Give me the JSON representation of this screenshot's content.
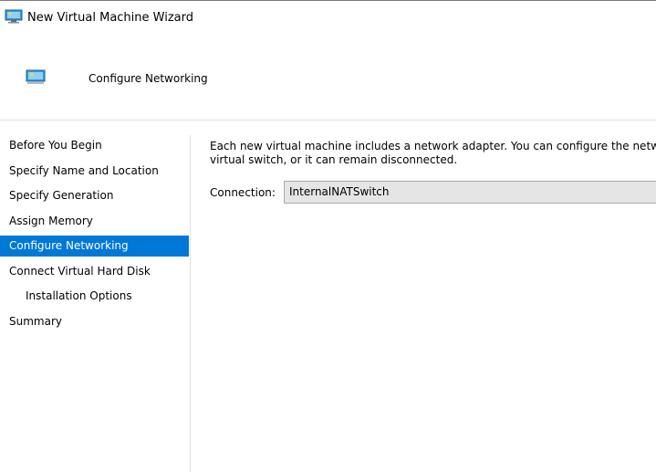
{
  "window": {
    "title": "New Virtual Machine Wizard",
    "app_icon": "virtual-machine-icon"
  },
  "header": {
    "page_title": "Configure Networking",
    "page_icon": "virtual-machine-icon"
  },
  "sidebar": {
    "selected_index": 4,
    "items": [
      {
        "label": "Before You Begin"
      },
      {
        "label": "Specify Name and Location"
      },
      {
        "label": "Specify Generation"
      },
      {
        "label": "Assign Memory"
      },
      {
        "label": "Configure Networking"
      },
      {
        "label": "Connect Virtual Hard Disk"
      },
      {
        "label": "Installation Options"
      },
      {
        "label": "Summary"
      }
    ]
  },
  "main": {
    "description_line1": "Each new virtual machine includes a network adapter. You can configure the netw",
    "description_line2": "virtual switch, or it can remain disconnected.",
    "connection_label": "Connection:",
    "connection_value": "InternalNATSwitch"
  },
  "colors": {
    "selected_bg": "#0078d7",
    "selected_fg": "#ffffff",
    "select_bg": "#e5e5e5"
  }
}
